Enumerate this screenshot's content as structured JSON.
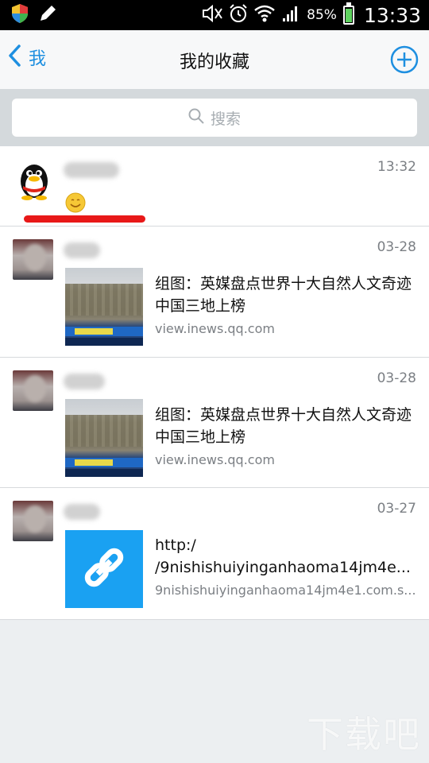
{
  "status_bar": {
    "battery_percent": "85%",
    "time": "13:33",
    "battery_level": 0.85,
    "icons": [
      "shield-icon",
      "pen-icon",
      "mute-icon",
      "alarm-icon",
      "wifi-icon",
      "signal-icon",
      "battery-icon"
    ]
  },
  "nav": {
    "back_label": "我",
    "title": "我的收藏",
    "add_icon": "plus-circle-icon"
  },
  "search": {
    "placeholder": "搜索"
  },
  "items": [
    {
      "time": "13:32",
      "type": "emoji"
    },
    {
      "time": "03-28",
      "title": "组图：英媒盘点世界十大自然人文奇迹 中国三地上榜",
      "subtitle": "view.inews.qq.com"
    },
    {
      "time": "03-28",
      "title": "组图：英媒盘点世界十大自然人文奇迹 中国三地上榜",
      "subtitle": "view.inews.qq.com"
    },
    {
      "time": "03-27",
      "title_line1": "http:/",
      "title_line2": "/9nishishuiyinganhaoma14jm4e...",
      "subtitle": "9nishishuiyinganhaoma14jm4e1.com.s..."
    }
  ],
  "colors": {
    "accent": "#1e8fe0",
    "link_tile": "#1aa1f2",
    "highlight_line": "#e81818"
  }
}
